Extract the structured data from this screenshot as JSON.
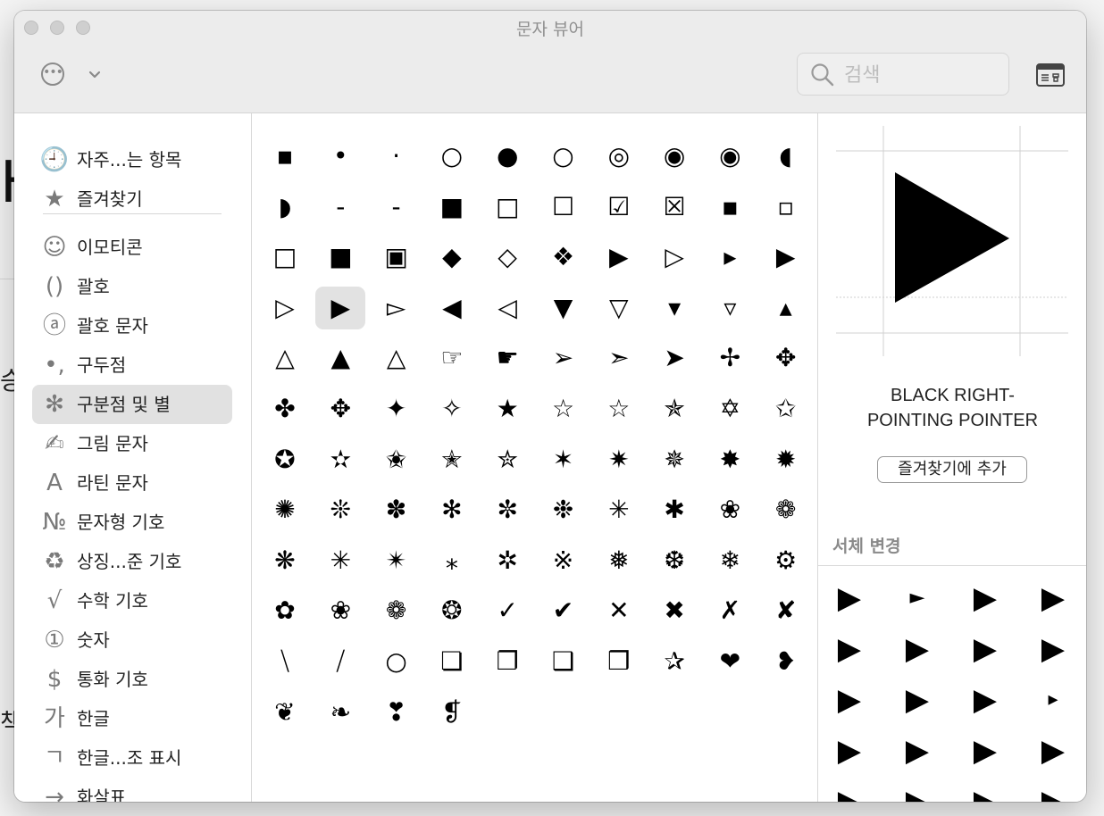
{
  "window": {
    "title": "문자 뷰어"
  },
  "search": {
    "placeholder": "검색"
  },
  "sidebar": {
    "items": [
      {
        "label": "자주...는 항목",
        "icon": "clock-icon",
        "glyph": "🕘"
      },
      {
        "label": "즐겨찾기",
        "icon": "star-icon",
        "glyph": "★"
      },
      {
        "label": "이모티콘",
        "icon": "smiley-icon",
        "glyph": "☺"
      },
      {
        "label": "괄호",
        "icon": "parentheses-icon",
        "glyph": "()"
      },
      {
        "label": "괄호 문자",
        "icon": "circled-a-icon",
        "glyph": "ⓐ"
      },
      {
        "label": "구두점",
        "icon": "punctuation-icon",
        "glyph": "•,"
      },
      {
        "label": "구분점 및 별",
        "icon": "asterisk-star-icon",
        "glyph": "✻"
      },
      {
        "label": "그림 문자",
        "icon": "writing-hand-icon",
        "glyph": "✍"
      },
      {
        "label": "라틴 문자",
        "icon": "latin-a-icon",
        "glyph": "A"
      },
      {
        "label": "문자형 기호",
        "icon": "numero-icon",
        "glyph": "№"
      },
      {
        "label": "상징...준 기호",
        "icon": "recycle-icon",
        "glyph": "♻"
      },
      {
        "label": "수학 기호",
        "icon": "square-root-icon",
        "glyph": "√"
      },
      {
        "label": "숫자",
        "icon": "circled-one-icon",
        "glyph": "①"
      },
      {
        "label": "통화 기호",
        "icon": "dollar-icon",
        "glyph": "$"
      },
      {
        "label": "한글",
        "icon": "hangul-ga-icon",
        "glyph": "가"
      },
      {
        "label": "한글...조 표시",
        "icon": "hangul-giyeok-icon",
        "glyph": "ㄱ"
      },
      {
        "label": "화살표",
        "icon": "arrow-right-icon",
        "glyph": "→"
      }
    ],
    "selected_index": 6
  },
  "grid": {
    "chars": [
      "▪",
      "•",
      "·",
      "○",
      "●",
      "○",
      "◎",
      "◉",
      "◉",
      "◖",
      "◗",
      "‐",
      "‑",
      "■",
      "□",
      "☐",
      "☑",
      "☒",
      "▪",
      "▫",
      "□",
      "■",
      "▣",
      "◆",
      "◇",
      "❖",
      "▶",
      "▷",
      "▸",
      "▶",
      "▷",
      "▶",
      "▻",
      "◀",
      "◁",
      "▼",
      "▽",
      "▾",
      "▿",
      "▴",
      "△",
      "▲",
      "△",
      "☞",
      "☛",
      "➢",
      "➣",
      "➤",
      "✢",
      "✥",
      "✤",
      "✥",
      "✦",
      "✧",
      "★",
      "☆",
      "☆",
      "✯",
      "✡",
      "✩",
      "✪",
      "✫",
      "✬",
      "✭",
      "✮",
      "✶",
      "✷",
      "✵",
      "✸",
      "✹",
      "✺",
      "❊",
      "✽",
      "✻",
      "✼",
      "❉",
      "✳",
      "✱",
      "❀",
      "❁",
      "❋",
      "✳",
      "✴",
      "⁎",
      "✲",
      "※",
      "❅",
      "❆",
      "❄",
      "⚙",
      "✿",
      "❀",
      "❁",
      "❂",
      "✓",
      "✔",
      "✕",
      "✖",
      "✗",
      "✘",
      "⧹",
      "⧸",
      "○",
      "❏",
      "❐",
      "❑",
      "❒",
      "✰",
      "❤",
      "❥",
      "❦",
      "❧",
      "❣",
      "❡"
    ],
    "selected_index": 31
  },
  "detail": {
    "char": "▶",
    "name": "BLACK RIGHT-POINTING POINTER",
    "name_line1": "BLACK RIGHT-",
    "name_line2": "POINTING POINTER",
    "add_favorite_label": "즐겨찾기에 추가",
    "font_variation_title": "서체 변경",
    "font_variations": [
      "▶",
      "►",
      "▶",
      "▶",
      "▶",
      "▶",
      "▶",
      "▶",
      "▶",
      "▶",
      "▶",
      "▸",
      "▶",
      "▶",
      "▶",
      "▶",
      "▶",
      "▶",
      "▶",
      "▶"
    ]
  }
}
